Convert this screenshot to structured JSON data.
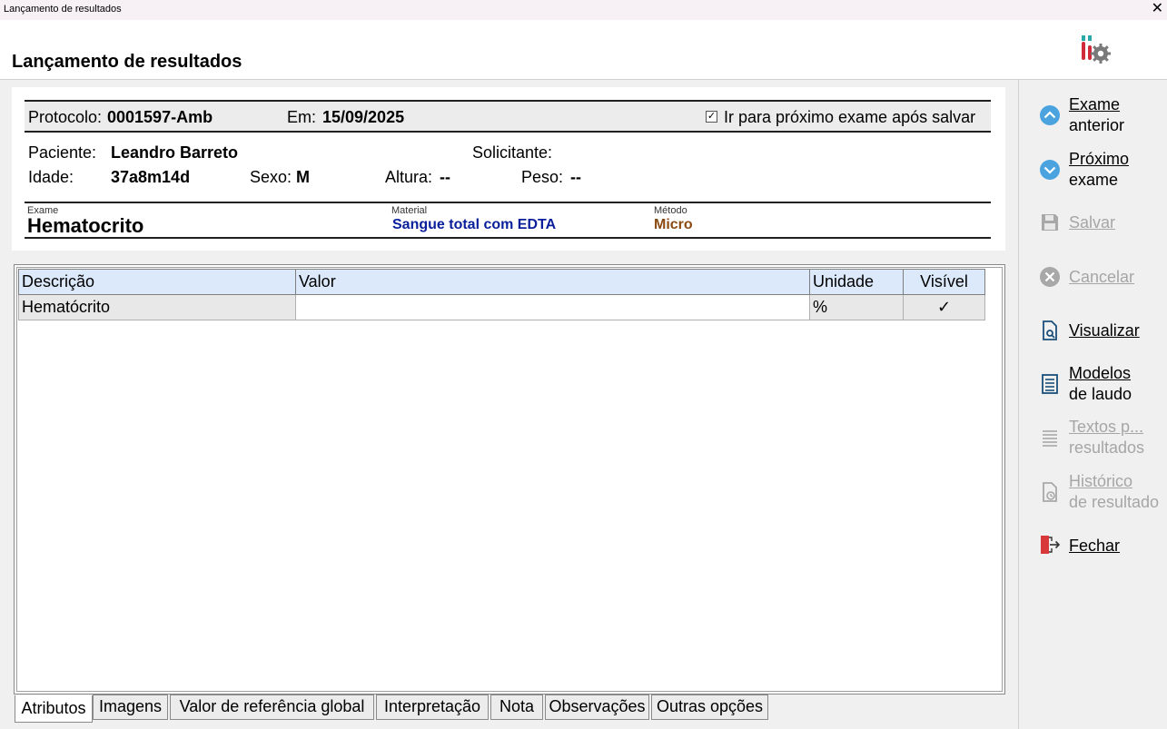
{
  "window": {
    "title": "Lançamento de resultados",
    "close_glyph": "✕"
  },
  "header": {
    "title": "Lançamento de resultados",
    "icon": "lab-tubes-gear-icon"
  },
  "protocol": {
    "label": "Protocolo:",
    "value": "0001597-Amb",
    "date_label": "Em:",
    "date": "15/09/2025",
    "next_checkbox_label": "Ir para próximo exame após salvar",
    "next_checked": true,
    "check_glyph": "✓"
  },
  "patient": {
    "name_label": "Paciente:",
    "name": "Leandro Barreto",
    "requester_label": "Solicitante:",
    "requester": "",
    "age_label": "Idade:",
    "age": "37a8m14d",
    "sex_label": "Sexo:",
    "sex": "M",
    "height_label": "Altura:",
    "height": "--",
    "weight_label": "Peso:",
    "weight": "--"
  },
  "exam": {
    "exam_label": "Exame",
    "exam": "Hematocrito",
    "material_label": "Material",
    "material": "Sangue total com EDTA",
    "method_label": "Método",
    "method": "Micro",
    "material_color": "#0a1f9a",
    "method_color": "#8b4a12"
  },
  "grid": {
    "headers": [
      "Descrição",
      "Valor",
      "Unidade",
      "Visível"
    ],
    "rows": [
      {
        "descricao": "Hematócrito",
        "valor": "",
        "unidade": "%",
        "visivel": "✓"
      }
    ]
  },
  "tabs": [
    "Atributos",
    "Imagens",
    "Valor de referência global",
    "Interpretação",
    "Nota",
    "Observações",
    "Outras opções"
  ],
  "sidebar": {
    "prev": {
      "line1": "Exame",
      "line2": "anterior"
    },
    "next": {
      "line1": "Próximo",
      "line2": "exame"
    },
    "save": "Salvar",
    "cancel": "Cancelar",
    "view": "Visualizar",
    "models": {
      "line1": "Modelos",
      "line2": "de laudo"
    },
    "texts": {
      "line1": "Textos p...",
      "line2": "resultados"
    },
    "history": {
      "line1": "Histórico",
      "line2": "de resultado"
    },
    "close": "Fechar"
  },
  "colors": {
    "header_blue": "#dbe9fb",
    "nav_icon": "#4aa3df",
    "close_icon": "#d9383a"
  }
}
